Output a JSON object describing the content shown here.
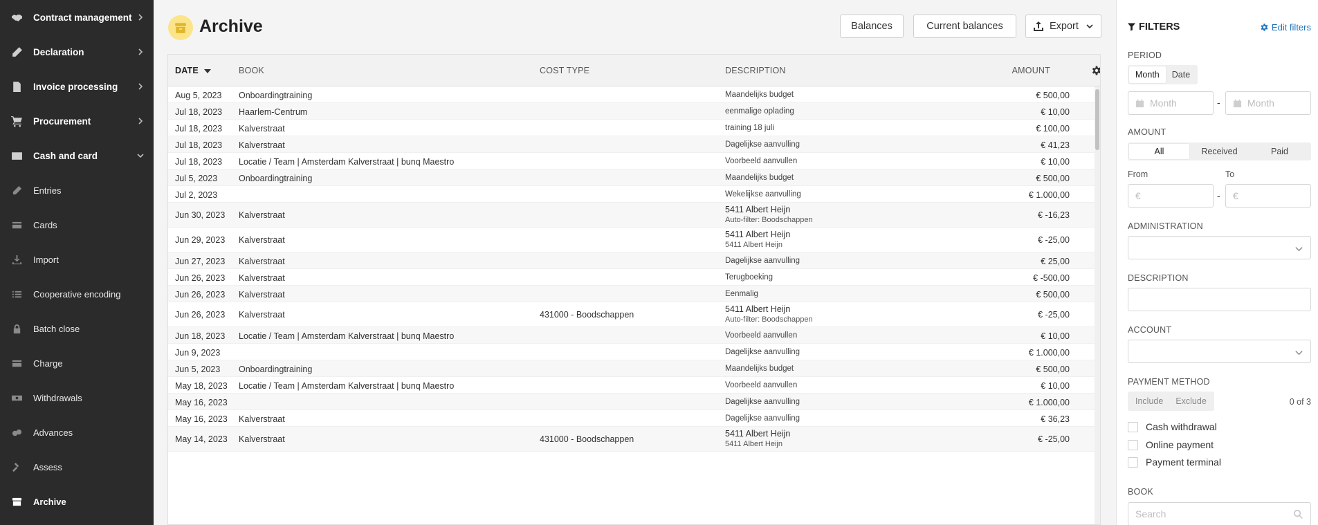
{
  "sidebar": {
    "items": [
      {
        "label": "Contract management",
        "icon": "handshake-icon",
        "chevron": "right",
        "level": "top"
      },
      {
        "label": "Declaration",
        "icon": "pencil-icon",
        "chevron": "right",
        "level": "top"
      },
      {
        "label": "Invoice processing",
        "icon": "invoice-icon",
        "chevron": "right",
        "level": "top"
      },
      {
        "label": "Procurement",
        "icon": "cart-icon",
        "chevron": "right",
        "level": "top"
      },
      {
        "label": "Cash and card",
        "icon": "wallet-card-icon",
        "chevron": "down",
        "level": "top"
      },
      {
        "label": "Entries",
        "icon": "pencil-icon",
        "level": "sub"
      },
      {
        "label": "Cards",
        "icon": "card-icon",
        "level": "sub"
      },
      {
        "label": "Import",
        "icon": "import-icon",
        "level": "sub"
      },
      {
        "label": "Cooperative encoding",
        "icon": "list-icon",
        "level": "sub"
      },
      {
        "label": "Batch close",
        "icon": "lock-icon",
        "level": "sub"
      },
      {
        "label": "Charge",
        "icon": "card-icon",
        "level": "sub"
      },
      {
        "label": "Withdrawals",
        "icon": "cash-icon",
        "level": "sub"
      },
      {
        "label": "Advances",
        "icon": "coins-icon",
        "level": "sub"
      },
      {
        "label": "Assess",
        "icon": "gavel-icon",
        "level": "sub"
      },
      {
        "label": "Archive",
        "icon": "archive-icon",
        "level": "sub",
        "active": true
      }
    ]
  },
  "header": {
    "title": "Archive",
    "buttons": {
      "balances": "Balances",
      "current_balances": "Current balances",
      "export": "Export"
    }
  },
  "table": {
    "columns": {
      "date": "DATE",
      "book": "BOOK",
      "cost_type": "COST TYPE",
      "description": "DESCRIPTION",
      "amount": "AMOUNT"
    },
    "rows": [
      {
        "date": "Aug 5, 2023",
        "book": "Onboardingtraining",
        "cost_type": "",
        "desc1": "Maandelijks budget",
        "desc2": "",
        "amount": "€ 500,00"
      },
      {
        "date": "Jul 18, 2023",
        "book": "Haarlem-Centrum",
        "cost_type": "",
        "desc1": "eenmalige oplading",
        "desc2": "",
        "amount": "€ 10,00"
      },
      {
        "date": "Jul 18, 2023",
        "book": "Kalverstraat",
        "cost_type": "",
        "desc1": "training 18 juli",
        "desc2": "",
        "amount": "€ 100,00"
      },
      {
        "date": "Jul 18, 2023",
        "book": "Kalverstraat",
        "cost_type": "",
        "desc1": "Dagelijkse aanvulling",
        "desc2": "",
        "amount": "€ 41,23"
      },
      {
        "date": "Jul 18, 2023",
        "book": "Locatie / Team | Amsterdam Kalverstraat | bunq Maestro",
        "cost_type": "",
        "desc1": "Voorbeeld aanvullen",
        "desc2": "",
        "amount": "€ 10,00"
      },
      {
        "date": "Jul 5, 2023",
        "book": "Onboardingtraining",
        "cost_type": "",
        "desc1": "Maandelijks budget",
        "desc2": "",
        "amount": "€ 500,00"
      },
      {
        "date": "Jul 2, 2023",
        "book": "",
        "cost_type": "",
        "desc1": "Wekelijkse aanvulling",
        "desc2": "",
        "amount": "€ 1.000,00"
      },
      {
        "date": "Jun 30, 2023",
        "book": "Kalverstraat",
        "cost_type": "",
        "desc1": "5411 Albert Heijn",
        "desc2": "Auto-filter: Boodschappen",
        "amount": "€ -16,23"
      },
      {
        "date": "Jun 29, 2023",
        "book": "Kalverstraat",
        "cost_type": "",
        "desc1": "5411 Albert Heijn",
        "desc2": "5411 Albert Heijn",
        "amount": "€ -25,00"
      },
      {
        "date": "Jun 27, 2023",
        "book": "Kalverstraat",
        "cost_type": "",
        "desc1": "Dagelijkse aanvulling",
        "desc2": "",
        "amount": "€ 25,00"
      },
      {
        "date": "Jun 26, 2023",
        "book": "Kalverstraat",
        "cost_type": "",
        "desc1": "Terugboeking",
        "desc2": "",
        "amount": "€ -500,00"
      },
      {
        "date": "Jun 26, 2023",
        "book": "Kalverstraat",
        "cost_type": "",
        "desc1": "Eenmalig",
        "desc2": "",
        "amount": "€ 500,00"
      },
      {
        "date": "Jun 26, 2023",
        "book": "Kalverstraat",
        "cost_type": "431000 - Boodschappen",
        "desc1": "5411 Albert Heijn",
        "desc2": "Auto-filter: Boodschappen",
        "amount": "€ -25,00"
      },
      {
        "date": "Jun 18, 2023",
        "book": "Locatie / Team | Amsterdam Kalverstraat | bunq Maestro",
        "cost_type": "",
        "desc1": "Voorbeeld aanvullen",
        "desc2": "",
        "amount": "€ 10,00"
      },
      {
        "date": "Jun 9, 2023",
        "book": "",
        "cost_type": "",
        "desc1": "Dagelijkse aanvulling",
        "desc2": "",
        "amount": "€ 1.000,00"
      },
      {
        "date": "Jun 5, 2023",
        "book": "Onboardingtraining",
        "cost_type": "",
        "desc1": "Maandelijks budget",
        "desc2": "",
        "amount": "€ 500,00"
      },
      {
        "date": "May 18, 2023",
        "book": "Locatie / Team | Amsterdam Kalverstraat | bunq Maestro",
        "cost_type": "",
        "desc1": "Voorbeeld aanvullen",
        "desc2": "",
        "amount": "€ 10,00"
      },
      {
        "date": "May 16, 2023",
        "book": "",
        "cost_type": "",
        "desc1": "Dagelijkse aanvulling",
        "desc2": "",
        "amount": "€ 1.000,00"
      },
      {
        "date": "May 16, 2023",
        "book": "Kalverstraat",
        "cost_type": "",
        "desc1": "Dagelijkse aanvulling",
        "desc2": "",
        "amount": "€ 36,23"
      },
      {
        "date": "May 14, 2023",
        "book": "Kalverstraat",
        "cost_type": "431000 - Boodschappen",
        "desc1": "5411 Albert Heijn",
        "desc2": "5411 Albert Heijn",
        "amount": "€ -25,00"
      }
    ]
  },
  "filters": {
    "title": "FILTERS",
    "edit": "Edit filters",
    "period": {
      "label": "PERIOD",
      "options": [
        "Month",
        "Date"
      ],
      "selected": "Month",
      "from_placeholder": "Month",
      "to_placeholder": "Month"
    },
    "amount": {
      "label": "AMOUNT",
      "options": [
        "All",
        "Received",
        "Paid"
      ],
      "selected": "All",
      "from_label": "From",
      "to_label": "To",
      "placeholder": "€"
    },
    "administration": {
      "label": "ADMINISTRATION"
    },
    "description": {
      "label": "DESCRIPTION"
    },
    "account": {
      "label": "ACCOUNT"
    },
    "payment_method": {
      "label": "PAYMENT METHOD",
      "options": [
        "Include",
        "Exclude"
      ],
      "count": "0 of 3",
      "choices": [
        "Cash withdrawal",
        "Online payment",
        "Payment terminal"
      ]
    },
    "book": {
      "label": "BOOK",
      "placeholder": "Search"
    }
  }
}
